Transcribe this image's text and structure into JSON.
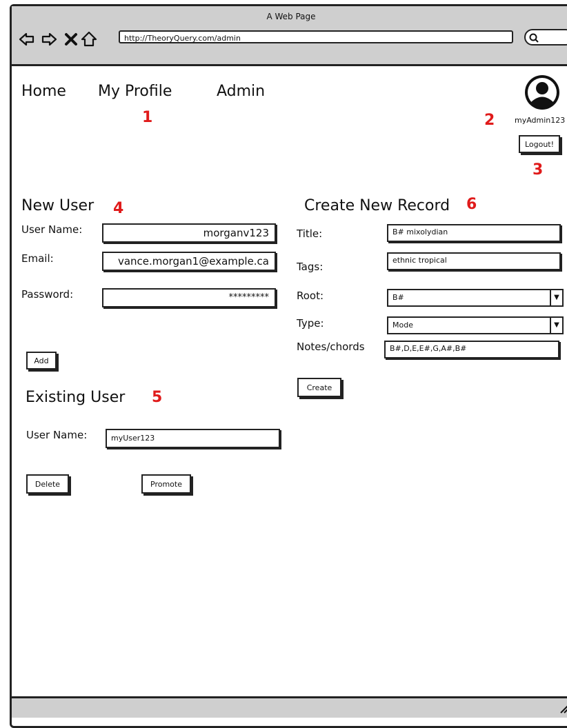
{
  "browser": {
    "window_title": "A Web Page",
    "url": "http://TheoryQuery.com/admin",
    "search_icon_glyph": "Q"
  },
  "nav": {
    "home": "Home",
    "my_profile": "My Profile",
    "admin": "Admin"
  },
  "annotations": {
    "n1": "1",
    "n2": "2",
    "n3": "3",
    "n4": "4",
    "n5": "5",
    "n6": "6",
    "color": "#e01b1b"
  },
  "account": {
    "username": "myAdmin123",
    "logout_label": "Logout!"
  },
  "new_user": {
    "title": "New User",
    "username_label": "User Name:",
    "username_value": "morganv123",
    "email_label": "Email:",
    "email_value": "vance.morgan1@example.ca",
    "password_label": "Password:",
    "password_value": "*********",
    "add_label": "Add"
  },
  "existing_user": {
    "title": "Existing User",
    "username_label": "User Name:",
    "username_value": "myUser123",
    "delete_label": "Delete",
    "promote_label": "Promote"
  },
  "create_record": {
    "title": "Create New Record",
    "title_label": "Title:",
    "title_value": "B# mixolydian",
    "tags_label": "Tags:",
    "tags_value": "ethnic tropical",
    "root_label": "Root:",
    "root_value": "B#",
    "type_label": "Type:",
    "type_value": "Mode",
    "notes_label": "Notes/chords",
    "notes_value": "B#,D,E,E#,G,A#,B#",
    "create_label": "Create"
  }
}
